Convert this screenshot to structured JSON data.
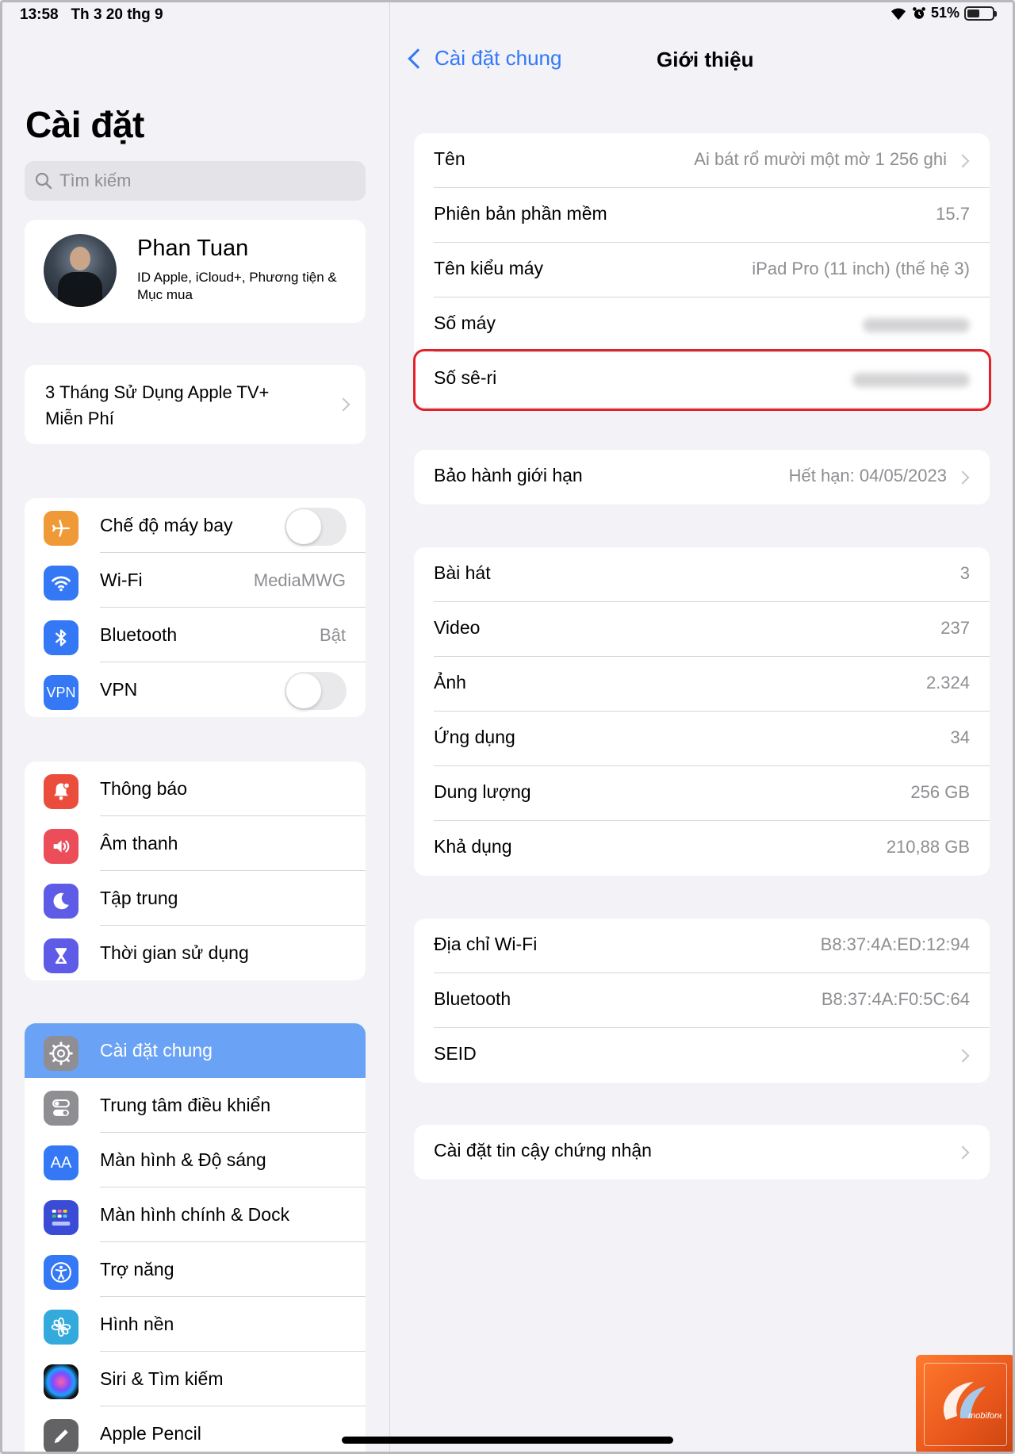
{
  "status_bar": {
    "time": "13:58",
    "date": "Th 3 20 thg 9",
    "battery_percent": "51%",
    "battery_level": 0.51
  },
  "sidebar": {
    "title": "Cài đặt",
    "search_placeholder": "Tìm kiếm",
    "profile": {
      "name": "Phan Tuan",
      "subtitle": "ID Apple, iCloud+, Phương tiện & Mục mua"
    },
    "promo": "3 Tháng Sử Dụng Apple TV+ Miễn Phí",
    "group1": [
      {
        "label": "Chế độ máy bay",
        "icon": "airplane-icon",
        "color": "#f09a37",
        "toggle": false
      },
      {
        "label": "Wi-Fi",
        "value": "MediaMWG",
        "icon": "wifi-icon",
        "color": "#3478f6"
      },
      {
        "label": "Bluetooth",
        "value": "Bật",
        "icon": "bluetooth-icon",
        "color": "#3478f6"
      },
      {
        "label": "VPN",
        "icon": "vpn-icon",
        "icon_text": "VPN",
        "color": "#3478f6",
        "toggle": false
      }
    ],
    "group2": [
      {
        "label": "Thông báo",
        "icon": "bell-icon",
        "color": "#eb4d3d"
      },
      {
        "label": "Âm thanh",
        "icon": "speaker-icon",
        "color": "#eb4d59"
      },
      {
        "label": "Tập trung",
        "icon": "moon-icon",
        "color": "#5e5ce6"
      },
      {
        "label": "Thời gian sử dụng",
        "icon": "hourglass-icon",
        "color": "#5e5ce6"
      }
    ],
    "group3": [
      {
        "label": "Cài đặt chung",
        "icon": "gear-icon",
        "color": "#8e8e93",
        "selected": true
      },
      {
        "label": "Trung tâm điều khiển",
        "icon": "control-center-icon",
        "color": "#8e8e93"
      },
      {
        "label": "Màn hình & Độ sáng",
        "icon": "display-icon",
        "icon_text": "AA",
        "color": "#3478f6"
      },
      {
        "label": "Màn hình chính & Dock",
        "icon": "home-screen-icon",
        "color": "#3a4cd6"
      },
      {
        "label": "Trợ năng",
        "icon": "accessibility-icon",
        "color": "#3478f6"
      },
      {
        "label": "Hình nền",
        "icon": "wallpaper-icon",
        "color": "#34aadc"
      },
      {
        "label": "Siri & Tìm kiếm",
        "icon": "siri-icon",
        "color": "#222"
      },
      {
        "label": "Apple Pencil",
        "icon": "pencil-icon",
        "color": "#636366"
      }
    ]
  },
  "detail": {
    "back_label": "Cài đặt chung",
    "title": "Giới thiệu",
    "section1": [
      {
        "label": "Tên",
        "value": "Ai bát rổ mười một mờ 1 256 ghi",
        "chevron": true
      },
      {
        "label": "Phiên bản phần mềm",
        "value": "15.7"
      },
      {
        "label": "Tên kiểu máy",
        "value": "iPad Pro (11 inch) (thế hệ 3)"
      },
      {
        "label": "Số máy",
        "blurred": true
      },
      {
        "label": "Số sê-ri",
        "blurred": true
      }
    ],
    "section2": [
      {
        "label": "Bảo hành giới hạn",
        "value": "Hết hạn: 04/05/2023",
        "chevron": true
      }
    ],
    "section3": [
      {
        "label": "Bài hát",
        "value": "3"
      },
      {
        "label": "Video",
        "value": "237"
      },
      {
        "label": "Ảnh",
        "value": "2.324"
      },
      {
        "label": "Ứng dụng",
        "value": "34"
      },
      {
        "label": "Dung lượng",
        "value": "256 GB"
      },
      {
        "label": "Khả dụng",
        "value": "210,88 GB"
      }
    ],
    "section4": [
      {
        "label": "Địa chỉ Wi-Fi",
        "value": "B8:37:4A:ED:12:94"
      },
      {
        "label": "Bluetooth",
        "value": "B8:37:4A:F0:5C:64"
      },
      {
        "label": "SEID",
        "chevron": true
      }
    ],
    "section5": [
      {
        "label": "Cài đặt tin cậy chứng nhận",
        "chevron": true
      }
    ]
  },
  "watermark_text": "mobifone9"
}
